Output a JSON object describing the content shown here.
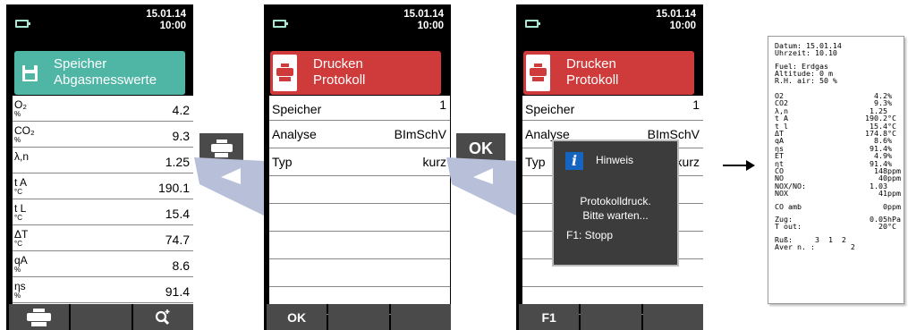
{
  "colors": {
    "teal": "#4fb5a5",
    "red": "#cf3b3b",
    "softkey": "#4a4a4a",
    "popup_bg": "#3c3c3c",
    "info_blue": "#1565c0"
  },
  "screen1": {
    "date": "15.01.14",
    "time": "10:00",
    "header_icon": "floppy-disk-icon",
    "header_title_1": "Speicher",
    "header_title_2": "Abgasmesswerte",
    "rows": [
      {
        "name": "O₂",
        "unit": "%",
        "value": "4.2"
      },
      {
        "name": "CO₂",
        "unit": "%",
        "value": "9.3"
      },
      {
        "name": "λ,n",
        "unit": "",
        "value": "1.25"
      },
      {
        "name": "t A",
        "unit": "°C",
        "value": "190.1"
      },
      {
        "name": "t L",
        "unit": "°C",
        "value": "15.4"
      },
      {
        "name": "ΔT",
        "unit": "°C",
        "value": "74.7"
      },
      {
        "name": "qA",
        "unit": "%",
        "value": "8.6"
      },
      {
        "name": "ηs",
        "unit": "%",
        "value": "91.4"
      }
    ],
    "softkeys": [
      "printer-icon",
      "",
      "magnify-plus-icon"
    ]
  },
  "key1": {
    "icon": "printer-icon"
  },
  "screen2": {
    "date": "15.01.14",
    "time": "10:00",
    "header_icon": "printer-icon",
    "header_title_1": "Drucken",
    "header_title_2": "Protokoll",
    "rows": [
      {
        "label": "Speicher",
        "value": "1"
      },
      {
        "label": "Analyse",
        "value": "BImSchV"
      },
      {
        "label": "Typ",
        "value": "kurz"
      }
    ],
    "softkeys": [
      "OK",
      "",
      ""
    ]
  },
  "key2": {
    "label": "OK"
  },
  "screen3": {
    "date": "15.01.14",
    "time": "10:00",
    "header_icon": "printer-icon",
    "header_title_1": "Drucken",
    "header_title_2": "Protokoll",
    "rows": [
      {
        "label": "Speicher",
        "value": "1"
      },
      {
        "label": "Analyse",
        "value": "BImSchV"
      },
      {
        "label": "Typ",
        "value": "kurz"
      }
    ],
    "softkeys": [
      "F1",
      "",
      ""
    ],
    "popup": {
      "icon": "info-icon",
      "title": "Hinweis",
      "message_1": "Protokolldruck.",
      "message_2": "Bitte warten...",
      "action": "F1: Stopp"
    }
  },
  "printout": {
    "date_line": "Datum: 15.01.14",
    "time_line": "Uhrzeit: 10.10",
    "fuel_line": "Fuel: Erdgas",
    "altitude_line": "Altitude: 0 m",
    "rh_line": "R.H. air: 50 %",
    "rows": [
      {
        "label": "O2",
        "value": "4.2",
        "unit": "%"
      },
      {
        "label": "CO2",
        "value": "9.3",
        "unit": "%"
      },
      {
        "label": "λ,n",
        "value": "1.25",
        "unit": ""
      },
      {
        "label": "t A",
        "value": "190.2",
        "unit": "°C"
      },
      {
        "label": "t l",
        "value": "15.4",
        "unit": "°C"
      },
      {
        "label": "ΔT",
        "value": "174.8",
        "unit": "°C"
      },
      {
        "label": "qA",
        "value": "8.6",
        "unit": "%"
      },
      {
        "label": "ηs",
        "value": "91.4",
        "unit": "%"
      },
      {
        "label": "ET",
        "value": "4.9",
        "unit": "%"
      },
      {
        "label": "ηt",
        "value": "91.4",
        "unit": "%"
      },
      {
        "label": "CO",
        "value": "148",
        "unit": "ppm"
      },
      {
        "label": "NO",
        "value": "40",
        "unit": "ppm"
      },
      {
        "label": "NOX/NO:",
        "value": "1.03",
        "unit": ""
      },
      {
        "label": "NOX",
        "value": "41",
        "unit": "ppm"
      }
    ],
    "co_amb": {
      "label": "CO amb",
      "value": "0",
      "unit": "ppm"
    },
    "zug": {
      "label": "Zug:",
      "value": "0.05",
      "unit": "hPa"
    },
    "tout": {
      "label": "T out:",
      "value": "20",
      "unit": "°C"
    },
    "russ_line": "Ruß:     3  1  2",
    "aver_line": "Aver n. :        2"
  }
}
